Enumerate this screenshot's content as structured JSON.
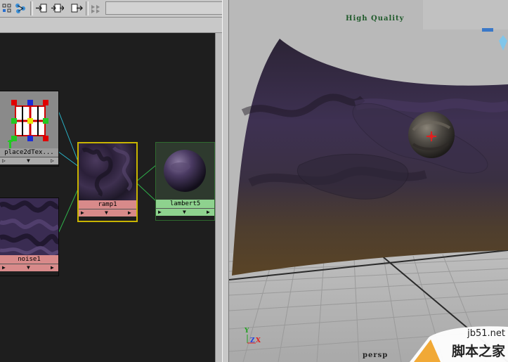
{
  "toolbar": {
    "buttons": [
      {
        "name": "hypergraph-grid-icon"
      },
      {
        "name": "hypergraph-network-icon"
      },
      {
        "name": "input-connections-icon"
      },
      {
        "name": "input-output-connections-icon"
      },
      {
        "name": "output-connections-icon"
      },
      {
        "name": "graph-layout-icon"
      }
    ]
  },
  "nodes": {
    "place2d": {
      "label": "place2dTex..."
    },
    "ramp": {
      "label": "ramp1"
    },
    "lambert": {
      "label": "lambert5"
    },
    "noise": {
      "label": "noise1"
    }
  },
  "viewport": {
    "quality_label": "High Quality",
    "camera_label": "persp",
    "axis_labels": {
      "y": "Y",
      "z": "Z",
      "x": "X"
    }
  },
  "watermark": {
    "site": "jb51.net",
    "text": "脚本之家"
  },
  "colors": {
    "graph_bg": "#1e1e1e",
    "texture_label_bg": "#d88a8a",
    "shader_label_bg": "#8ed28e",
    "selected_border": "#c8b400",
    "connection_cyan": "#2ab4c8",
    "connection_green": "#2fb04a",
    "quality_text": "#1f5a2a"
  }
}
